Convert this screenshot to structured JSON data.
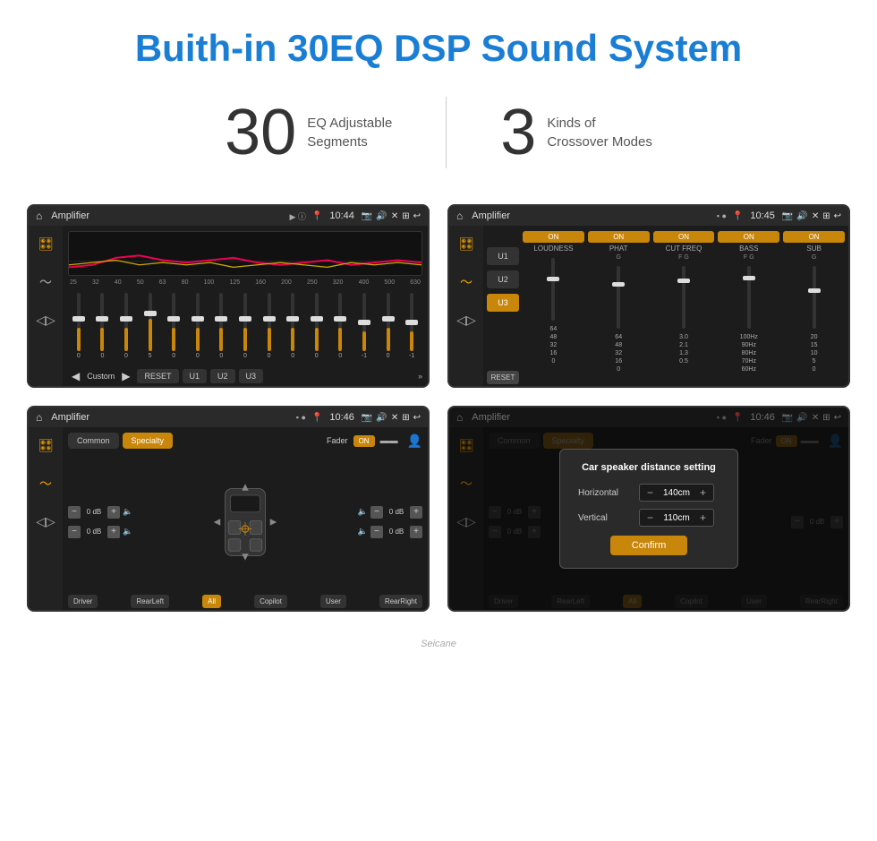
{
  "header": {
    "title": "Buith-in 30EQ DSP Sound System"
  },
  "stats": {
    "eq_number": "30",
    "eq_label_line1": "EQ Adjustable",
    "eq_label_line2": "Segments",
    "crossover_number": "3",
    "crossover_label_line1": "Kinds of",
    "crossover_label_line2": "Crossover Modes"
  },
  "screen1": {
    "title": "Amplifier",
    "time": "10:44",
    "mode": "Custom",
    "freqs": [
      "25",
      "32",
      "40",
      "50",
      "63",
      "80",
      "100",
      "125",
      "160",
      "200",
      "250",
      "320",
      "400",
      "500",
      "630"
    ],
    "values": [
      "0",
      "0",
      "0",
      "5",
      "0",
      "0",
      "0",
      "0",
      "0",
      "0",
      "0",
      "0",
      "-1",
      "0",
      "-1"
    ],
    "presets": [
      "RESET",
      "U1",
      "U2",
      "U3"
    ]
  },
  "screen2": {
    "title": "Amplifier",
    "time": "10:45",
    "presets": [
      "U1",
      "U2",
      "U3"
    ],
    "channels": [
      "LOUDNESS",
      "PHAT",
      "CUT FREQ",
      "BASS",
      "SUB"
    ],
    "active_preset": "U3",
    "reset_label": "RESET"
  },
  "screen3": {
    "title": "Amplifier",
    "time": "10:46",
    "tabs": [
      "Common",
      "Specialty"
    ],
    "active_tab": "Specialty",
    "fader_label": "Fader",
    "fader_on": "ON",
    "vol_labels": [
      "0 dB",
      "0 dB",
      "0 dB",
      "0 dB"
    ],
    "speaker_positions": [
      "Driver",
      "RearLeft",
      "All",
      "Copilot",
      "User",
      "RearRight"
    ]
  },
  "screen4": {
    "title": "Amplifier",
    "time": "10:46",
    "tabs": [
      "Common",
      "Specialty"
    ],
    "active_tab": "Specialty",
    "dialog": {
      "title": "Car speaker distance setting",
      "horizontal_label": "Horizontal",
      "horizontal_value": "140cm",
      "vertical_label": "Vertical",
      "vertical_value": "110cm",
      "confirm_label": "Confirm"
    },
    "vol_labels": [
      "0 dB",
      "0 dB"
    ],
    "speaker_positions": [
      "Driver",
      "RearLeft",
      "All",
      "Copilot",
      "User",
      "RearRight"
    ]
  },
  "watermark": "Seicane"
}
